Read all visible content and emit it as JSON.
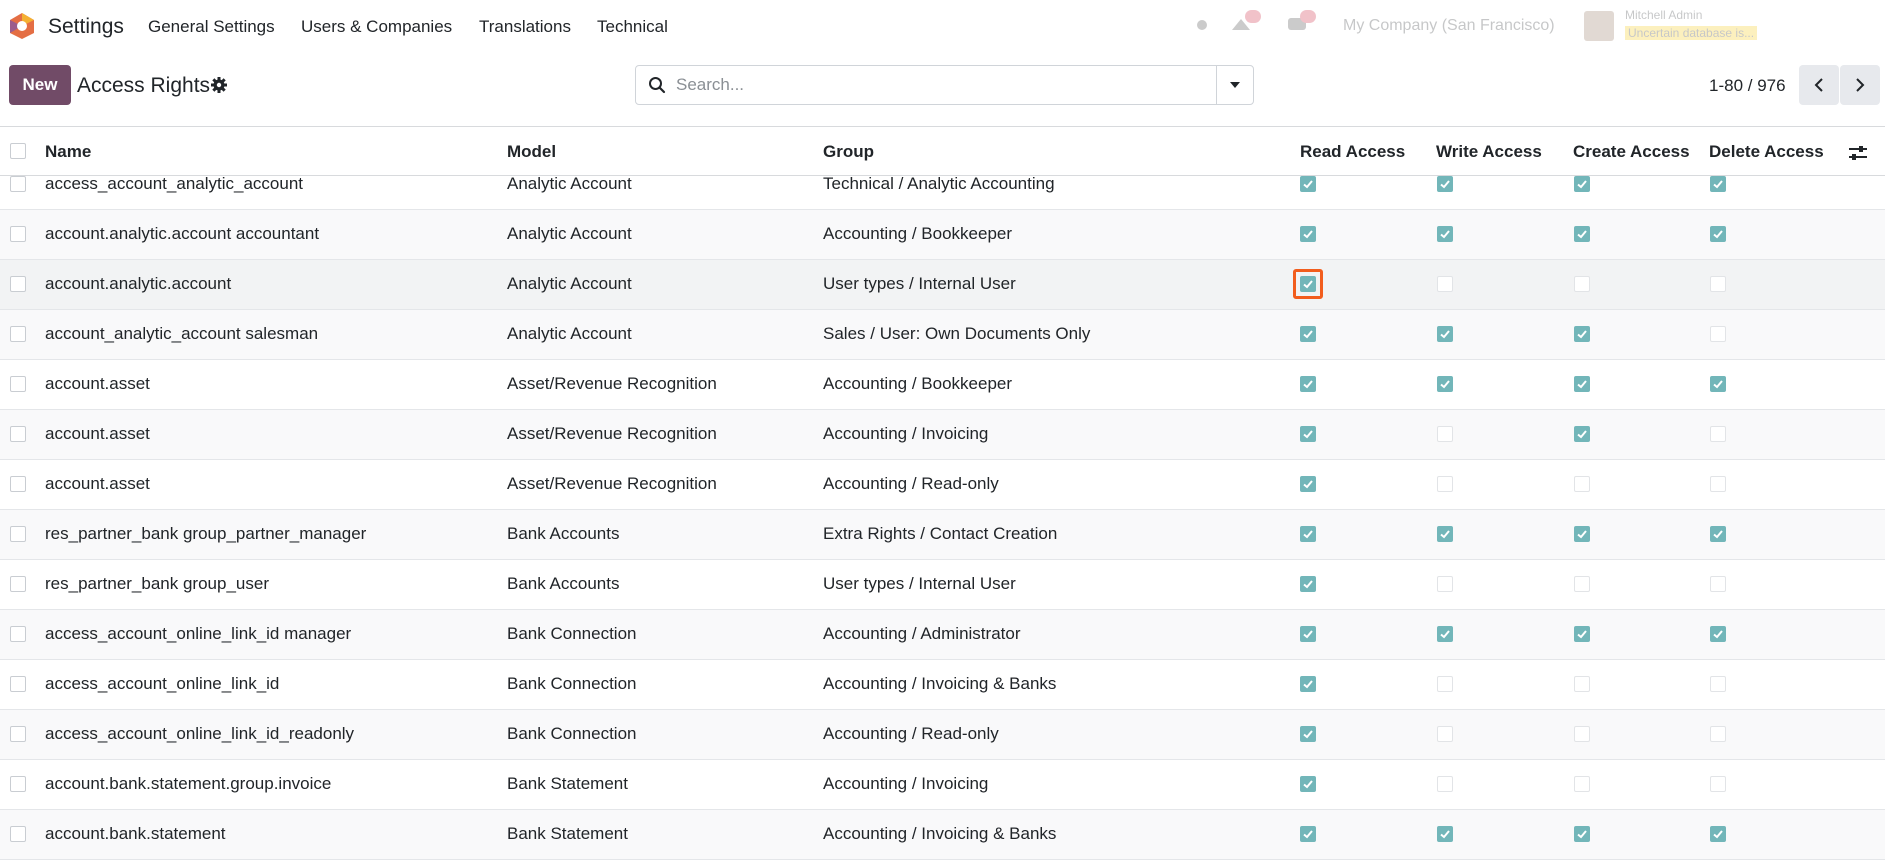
{
  "navbar": {
    "app_name": "Settings",
    "menu": [
      "General Settings",
      "Users & Companies",
      "Translations",
      "Technical"
    ],
    "company": "My Company (San Francisco)",
    "user_name": "Mitchell Admin",
    "user_db": "Uncertain database is..."
  },
  "control": {
    "new_label": "New",
    "title": "Access Rights",
    "search_placeholder": "Search...",
    "pager": "1-80 / 976"
  },
  "table": {
    "headers": [
      "Name",
      "Model",
      "Group",
      "Read Access",
      "Write Access",
      "Create Access",
      "Delete Access"
    ],
    "rows": [
      {
        "name": "access_account_analytic_account",
        "model": "Analytic Account",
        "group": "Technical / Analytic Accounting",
        "read": true,
        "write": true,
        "create": true,
        "delete": true
      },
      {
        "name": "account.analytic.account accountant",
        "model": "Analytic Account",
        "group": "Accounting / Bookkeeper",
        "read": true,
        "write": true,
        "create": true,
        "delete": true
      },
      {
        "name": "account.analytic.account",
        "model": "Analytic Account",
        "group": "User types / Internal User",
        "read": true,
        "write": false,
        "create": false,
        "delete": false
      },
      {
        "name": "account_analytic_account salesman",
        "model": "Analytic Account",
        "group": "Sales / User: Own Documents Only",
        "read": true,
        "write": true,
        "create": true,
        "delete": false
      },
      {
        "name": "account.asset",
        "model": "Asset/Revenue Recognition",
        "group": "Accounting / Bookkeeper",
        "read": true,
        "write": true,
        "create": true,
        "delete": true
      },
      {
        "name": "account.asset",
        "model": "Asset/Revenue Recognition",
        "group": "Accounting / Invoicing",
        "read": true,
        "write": false,
        "create": true,
        "delete": false
      },
      {
        "name": "account.asset",
        "model": "Asset/Revenue Recognition",
        "group": "Accounting / Read-only",
        "read": true,
        "write": false,
        "create": false,
        "delete": false
      },
      {
        "name": "res_partner_bank group_partner_manager",
        "model": "Bank Accounts",
        "group": "Extra Rights / Contact Creation",
        "read": true,
        "write": true,
        "create": true,
        "delete": true
      },
      {
        "name": "res_partner_bank group_user",
        "model": "Bank Accounts",
        "group": "User types / Internal User",
        "read": true,
        "write": false,
        "create": false,
        "delete": false
      },
      {
        "name": "access_account_online_link_id manager",
        "model": "Bank Connection",
        "group": "Accounting / Administrator",
        "read": true,
        "write": true,
        "create": true,
        "delete": true
      },
      {
        "name": "access_account_online_link_id",
        "model": "Bank Connection",
        "group": "Accounting / Invoicing & Banks",
        "read": true,
        "write": false,
        "create": false,
        "delete": false
      },
      {
        "name": "access_account_online_link_id_readonly",
        "model": "Bank Connection",
        "group": "Accounting / Read-only",
        "read": true,
        "write": false,
        "create": false,
        "delete": false
      },
      {
        "name": "account.bank.statement.group.invoice",
        "model": "Bank Statement",
        "group": "Accounting / Invoicing",
        "read": true,
        "write": false,
        "create": false,
        "delete": false
      },
      {
        "name": "account.bank.statement",
        "model": "Bank Statement",
        "group": "Accounting / Invoicing & Banks",
        "read": true,
        "write": true,
        "create": true,
        "delete": true
      }
    ]
  },
  "colors": {
    "brand": "#714b67",
    "checkbox_on": "#72b6b9",
    "focus": "#f25d1d"
  }
}
